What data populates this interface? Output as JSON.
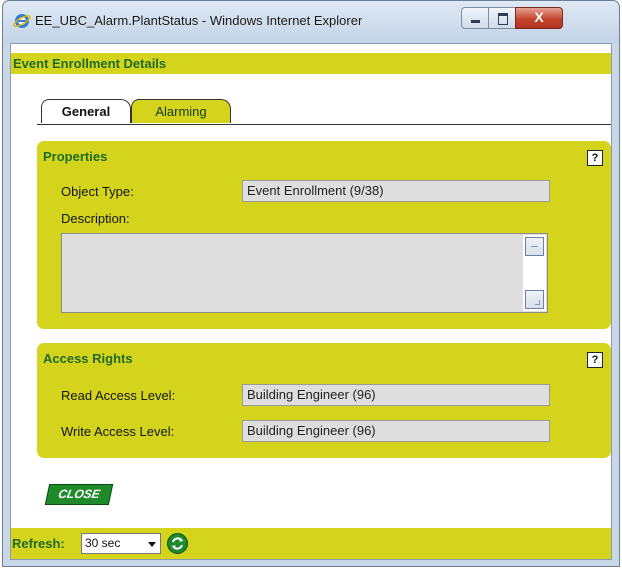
{
  "window": {
    "title": "EE_UBC_Alarm.PlantStatus - Windows Internet Explorer",
    "icons": {
      "app": "ie-icon",
      "minimize": "minimize-icon",
      "maximize": "maximize-icon",
      "close": "close-icon"
    },
    "close_glyph": "X"
  },
  "page": {
    "header": "Event Enrollment Details"
  },
  "tabs": [
    {
      "label": "General",
      "active": true
    },
    {
      "label": "Alarming",
      "active": false
    }
  ],
  "properties": {
    "title": "Properties",
    "help": "?",
    "object_type_label": "Object Type:",
    "object_type_value": "Event Enrollment (9/38)",
    "description_label": "Description:",
    "description_value": ""
  },
  "access_rights": {
    "title": "Access Rights",
    "help": "?",
    "read_label": "Read Access Level:",
    "read_value": "Building Engineer (96)",
    "write_label": "Write Access Level:",
    "write_value": "Building Engineer (96)"
  },
  "close_button": "CLOSE",
  "footer": {
    "refresh_label": "Refresh:",
    "refresh_selected": "30 sec",
    "refresh_icon": "refresh-icon"
  },
  "colors": {
    "accent": "#d4d41c",
    "title_green": "#1f6b2a",
    "button_green": "#1f8a2a"
  }
}
